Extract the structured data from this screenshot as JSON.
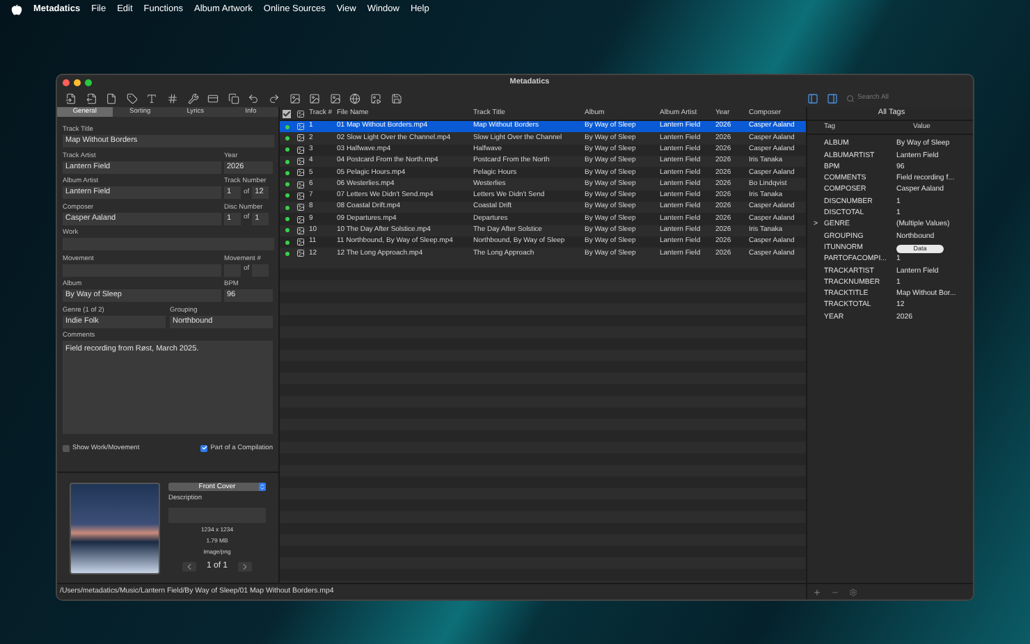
{
  "menu_bar": {
    "app_name": "Metadatics",
    "items": [
      "File",
      "Edit",
      "Functions",
      "Album Artwork",
      "Online Sources",
      "View",
      "Window",
      "Help"
    ]
  },
  "window": {
    "title": "Metadatics",
    "search": {
      "placeholder": "Search All"
    }
  },
  "editor": {
    "tabs": [
      {
        "label": "General",
        "selected": true
      },
      {
        "label": "Sorting",
        "selected": false
      },
      {
        "label": "Lyrics",
        "selected": false
      },
      {
        "label": "Info",
        "selected": false
      }
    ],
    "rows": [
      [
        {
          "kind": "wide",
          "label": "Track Title",
          "value": "Map Without Borders"
        }
      ],
      [
        {
          "kind": "main",
          "label": "Track Artist",
          "value": "Lantern Field"
        },
        {
          "kind": "side",
          "label": "Year",
          "value": "2026"
        }
      ],
      [
        {
          "kind": "main",
          "label": "Album Artist",
          "value": "Lantern Field"
        },
        {
          "kind": "pair",
          "label": "Track Number",
          "value": "1",
          "of": "of",
          "total": "12"
        }
      ],
      [
        {
          "kind": "main",
          "label": "Composer",
          "value": "Casper Aaland"
        },
        {
          "kind": "pair",
          "label": "Disc Number",
          "value": "1",
          "of": "of",
          "total": "1"
        }
      ],
      [
        {
          "kind": "wide",
          "label": "Work"
        }
      ],
      [
        {
          "kind": "main",
          "label": "Movement"
        },
        {
          "kind": "pair",
          "label": "Movement #",
          "of": "of"
        }
      ],
      [
        {
          "kind": "main",
          "label": "Album",
          "value": "By Way of Sleep"
        },
        {
          "kind": "side",
          "label": "BPM",
          "value": "96"
        }
      ],
      [
        {
          "kind": "half",
          "label": "Genre (1 of 2)",
          "value": "Indie Folk"
        },
        {
          "kind": "half",
          "label": "Grouping",
          "value": "Northbound"
        }
      ]
    ],
    "comments": {
      "label": "Comments",
      "value": "Field recording from Røst, March 2025."
    },
    "checkboxes": [
      {
        "label": "Show Work/Movement",
        "checked": false
      },
      {
        "label": "Part of a Compilation",
        "checked": true
      }
    ],
    "artwork": {
      "type": "Front Cover",
      "description_label": "Description",
      "dimensions": "1234 x 1234",
      "size": "1.79 MB",
      "mime": "image/png",
      "page": "1 of 1"
    }
  },
  "table": {
    "columns": [
      "Track #",
      "File Name",
      "Track Title",
      "Album",
      "Album Artist",
      "Year",
      "Composer"
    ],
    "rows": [
      {
        "selected": true,
        "cells": [
          "1",
          "01 Map Without Borders.mp4",
          "Map Without Borders",
          "By Way of Sleep",
          "Lantern Field",
          "2026",
          "Casper Aaland"
        ]
      },
      {
        "selected": false,
        "cells": [
          "2",
          "02 Slow Light Over the Channel.mp4",
          "Slow Light Over the Channel",
          "By Way of Sleep",
          "Lantern Field",
          "2026",
          "Casper Aaland"
        ]
      },
      {
        "selected": false,
        "cells": [
          "3",
          "03 Halfwave.mp4",
          "Halfwave",
          "By Way of Sleep",
          "Lantern Field",
          "2026",
          "Casper Aaland"
        ]
      },
      {
        "selected": false,
        "cells": [
          "4",
          "04 Postcard From the North.mp4",
          "Postcard From the North",
          "By Way of Sleep",
          "Lantern Field",
          "2026",
          "Iris Tanaka"
        ]
      },
      {
        "selected": false,
        "cells": [
          "5",
          "05 Pelagic Hours.mp4",
          "Pelagic Hours",
          "By Way of Sleep",
          "Lantern Field",
          "2026",
          "Casper Aaland"
        ]
      },
      {
        "selected": false,
        "cells": [
          "6",
          "06 Westerlies.mp4",
          "Westerlies",
          "By Way of Sleep",
          "Lantern Field",
          "2026",
          "Bo Lindqvist"
        ]
      },
      {
        "selected": false,
        "cells": [
          "7",
          "07 Letters We Didn't Send.mp4",
          "Letters We Didn't Send",
          "By Way of Sleep",
          "Lantern Field",
          "2026",
          "Iris Tanaka"
        ]
      },
      {
        "selected": false,
        "cells": [
          "8",
          "08 Coastal Drift.mp4",
          "Coastal Drift",
          "By Way of Sleep",
          "Lantern Field",
          "2026",
          "Casper Aaland"
        ]
      },
      {
        "selected": false,
        "cells": [
          "9",
          "09 Departures.mp4",
          "Departures",
          "By Way of Sleep",
          "Lantern Field",
          "2026",
          "Casper Aaland"
        ]
      },
      {
        "selected": false,
        "cells": [
          "10",
          "10 The Day After Solstice.mp4",
          "The Day After Solstice",
          "By Way of Sleep",
          "Lantern Field",
          "2026",
          "Iris Tanaka"
        ]
      },
      {
        "selected": false,
        "cells": [
          "11",
          "11 Northbound, By Way of Sleep.mp4",
          "Northbound, By Way of Sleep",
          "By Way of Sleep",
          "Lantern Field",
          "2026",
          "Casper Aaland"
        ]
      },
      {
        "selected": false,
        "cells": [
          "12",
          "12 The Long Approach.mp4",
          "The Long Approach",
          "By Way of Sleep",
          "Lantern Field",
          "2026",
          "Casper Aaland"
        ]
      }
    ]
  },
  "tags_panel": {
    "title": "All Tags",
    "columns": [
      "Tag",
      "Value"
    ],
    "rows": [
      {
        "kind": "text",
        "tag": "ALBUM",
        "value": "By Way of Sleep"
      },
      {
        "kind": "text",
        "tag": "ALBUMARTIST",
        "value": "Lantern Field"
      },
      {
        "kind": "text",
        "tag": "BPM",
        "value": "96"
      },
      {
        "kind": "text",
        "tag": "COMMENTS",
        "value": "Field recording f..."
      },
      {
        "kind": "text",
        "tag": "COMPOSER",
        "value": "Casper Aaland"
      },
      {
        "kind": "text",
        "tag": "DISCNUMBER",
        "value": "1"
      },
      {
        "kind": "text",
        "tag": "DISCTOTAL",
        "value": "1"
      },
      {
        "kind": "group",
        "tag": "GENRE",
        "value": "(Multiple Values)",
        "toggle": ">"
      },
      {
        "kind": "text",
        "tag": "GROUPING",
        "value": "Northbound"
      },
      {
        "kind": "data",
        "tag": "ITUNNORM",
        "value": "Data"
      },
      {
        "kind": "text",
        "tag": "PARTOFACOMPI...",
        "value": "1"
      },
      {
        "kind": "text",
        "tag": "TRACKARTIST",
        "value": "Lantern Field"
      },
      {
        "kind": "text",
        "tag": "TRACKNUMBER",
        "value": "1"
      },
      {
        "kind": "text",
        "tag": "TRACKTITLE",
        "value": "Map Without Bor..."
      },
      {
        "kind": "text",
        "tag": "TRACKTOTAL",
        "value": "12"
      },
      {
        "kind": "text",
        "tag": "YEAR",
        "value": "2026"
      }
    ]
  },
  "status_bar": {
    "path": "/Users/metadatics/Music/Lantern Field/By Way of Sleep/01 Map Without Borders.mp4"
  }
}
